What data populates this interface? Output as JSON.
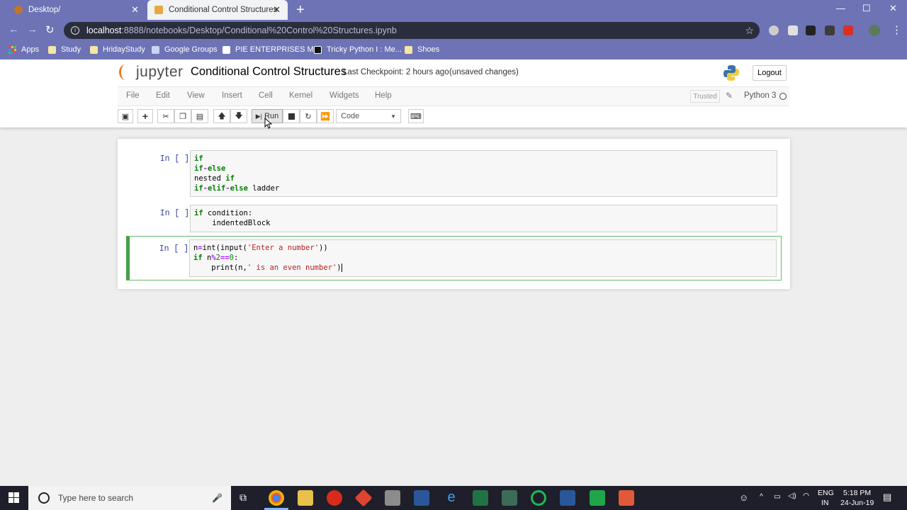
{
  "browser": {
    "tabs": [
      {
        "label": "Desktop/"
      },
      {
        "label": "Conditional Control Structures"
      }
    ],
    "new_tab_glyph": "+",
    "address": {
      "host": "localhost",
      "path": ":8888/notebooks/Desktop/Conditional%20Control%20Structures.ipynb"
    },
    "bookmarks": [
      {
        "label": "Apps"
      },
      {
        "label": "Study"
      },
      {
        "label": "HridayStudy"
      },
      {
        "label": "Google Groups"
      },
      {
        "label": "PIE ENTERPRISES M..."
      },
      {
        "label": "Tricky Python I : Me..."
      },
      {
        "label": "Shoes"
      }
    ]
  },
  "jupyter": {
    "logo_text": "jupyter",
    "notebook_title": "Conditional Control Structures",
    "checkpoint": "Last Checkpoint: 2 hours ago",
    "save_status": "(unsaved changes)",
    "logout_label": "Logout",
    "menus": [
      "File",
      "Edit",
      "View",
      "Insert",
      "Cell",
      "Kernel",
      "Widgets",
      "Help"
    ],
    "trusted_label": "Trusted",
    "kernel_name": "Python 3",
    "toolbar": {
      "run_label": "Run",
      "cell_type": "Code"
    },
    "cells": [
      {
        "prompt": "In [ ]:"
      },
      {
        "prompt": "In [ ]:"
      },
      {
        "prompt": "In [ ]:"
      }
    ]
  },
  "taskbar": {
    "search_placeholder": "Type here to search",
    "lang_top": "ENG",
    "lang_bottom": "IN",
    "time": "5:18 PM",
    "date": "24-Jun-19"
  },
  "colors": {
    "chrome_frame": "#6d73b5",
    "selected_cell_border": "#43a047",
    "jupyter_orange": "#f37726"
  }
}
